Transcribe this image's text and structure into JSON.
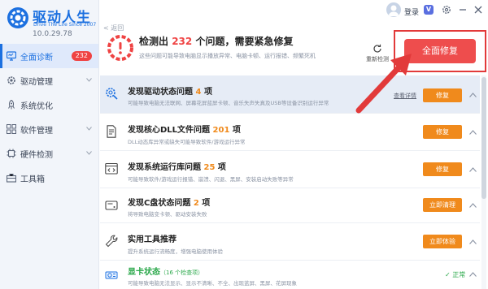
{
  "app": {
    "logo_icon": "gear-logo",
    "name": "驱动人生",
    "slogan": "Drive The Life  Since 2007",
    "version": "10.0.29.78",
    "brand_color": "#1c70e0"
  },
  "sidebar": {
    "items": [
      {
        "label": "全面诊断",
        "icon": "monitor-icon",
        "badge": "232",
        "active": true
      },
      {
        "label": "驱动管理",
        "icon": "gear-icon",
        "expandable": true
      },
      {
        "label": "系统优化",
        "icon": "rocket-icon"
      },
      {
        "label": "软件管理",
        "icon": "grid-icon",
        "expandable": true
      },
      {
        "label": "硬件检测",
        "icon": "chip-icon",
        "expandable": true
      },
      {
        "label": "工具箱",
        "icon": "toolbox-icon"
      }
    ]
  },
  "topbar": {
    "back_label": "返回",
    "login_label": "登录",
    "vip_label": "V",
    "icons": [
      "avatar-icon",
      "settings-icon",
      "minimize-icon",
      "close-icon"
    ]
  },
  "summary": {
    "title_prefix": "检测出",
    "issue_count": "232",
    "title_suffix": "个问题，需要紧急修复",
    "subtitle": "这些问题可能导致电脑显示播放异常、电脑卡顿、运行报错、频繁死机",
    "rescan_label": "重新检测",
    "fix_all_label": "全面修复",
    "warning_color": "#ef4343"
  },
  "rows": [
    {
      "icon": "gear-search-icon",
      "title": "发现驱动状态问题",
      "count": "4",
      "unit": "项",
      "desc": "可能导致电脑无法联网、屏幕花屏蓝屏卡顿、音乐失声失真及USB等设备识别运行异常",
      "link": "查看详情",
      "action": "修复",
      "highlight": true
    },
    {
      "icon": "document-icon",
      "title": "发现核心DLL文件问题",
      "count": "201",
      "unit": "项",
      "desc": "DLL动态库异常或缺失可能导致软件/游戏运行异常",
      "action": "修复"
    },
    {
      "icon": "code-window-icon",
      "title": "发现系统运行库问题",
      "count": "25",
      "unit": "项",
      "desc": "可能导致软件/游戏运行报错、崩溃、闪退、黑屏、安装启动失败等异常",
      "action": "修复"
    },
    {
      "icon": "disk-icon",
      "title": "发现C盘状态问题",
      "count": "2",
      "unit": "项",
      "desc": "将导致电脑变卡顿、驱动安装失败",
      "action": "立即清理"
    },
    {
      "icon": "wrench-icon",
      "title": "实用工具推荐",
      "desc": "提升系统运行流畅度，增强电脑使用体验",
      "action": "立即体验"
    },
    {
      "icon": "graphics-card-icon",
      "title": "显卡状态",
      "sub": "（16 个检查项）",
      "desc": "可能导致电脑无法显示、显示不清晰、不全、出现蓝屏、黑屏、花屏现象",
      "status": "正常",
      "status_color": "#2aa84a"
    }
  ],
  "colors": {
    "action": "#f08a1c",
    "fix_all": "#ee4d4d",
    "annotation": "#e23a3a"
  }
}
